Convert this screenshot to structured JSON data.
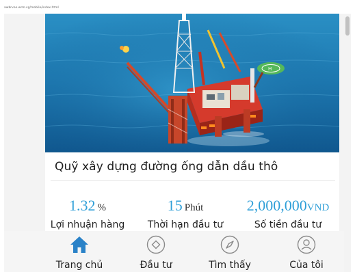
{
  "browser": {
    "url": "awbrvoo.wrm.vg/mobile/index.html"
  },
  "product": {
    "title": "Quỹ xây dựng đường ống dẫn dầu thô",
    "hero_image": "offshore-oil-rig-photo"
  },
  "stats": [
    {
      "value": "1.32",
      "unit": "%",
      "label": "Lợi nhuận hàng"
    },
    {
      "value": "15",
      "unit": "Phút",
      "label": "Thời hạn đầu tư"
    },
    {
      "value": "2,000,000",
      "unit": "VND",
      "label": "Số tiền đầu tư"
    }
  ],
  "tabbar": {
    "items": [
      {
        "label": "Trang chủ",
        "icon": "home-icon",
        "active": true
      },
      {
        "label": "Đầu tư",
        "icon": "diamond-icon",
        "active": false
      },
      {
        "label": "Tìm thấy",
        "icon": "compass-icon",
        "active": false
      },
      {
        "label": "Của tôi",
        "icon": "user-icon",
        "active": false
      }
    ]
  },
  "colors": {
    "accent": "#2f9fd8",
    "tab_active": "#2a82c8",
    "tab_inactive": "#8a8a8a",
    "sea": "#1f7fb8"
  }
}
